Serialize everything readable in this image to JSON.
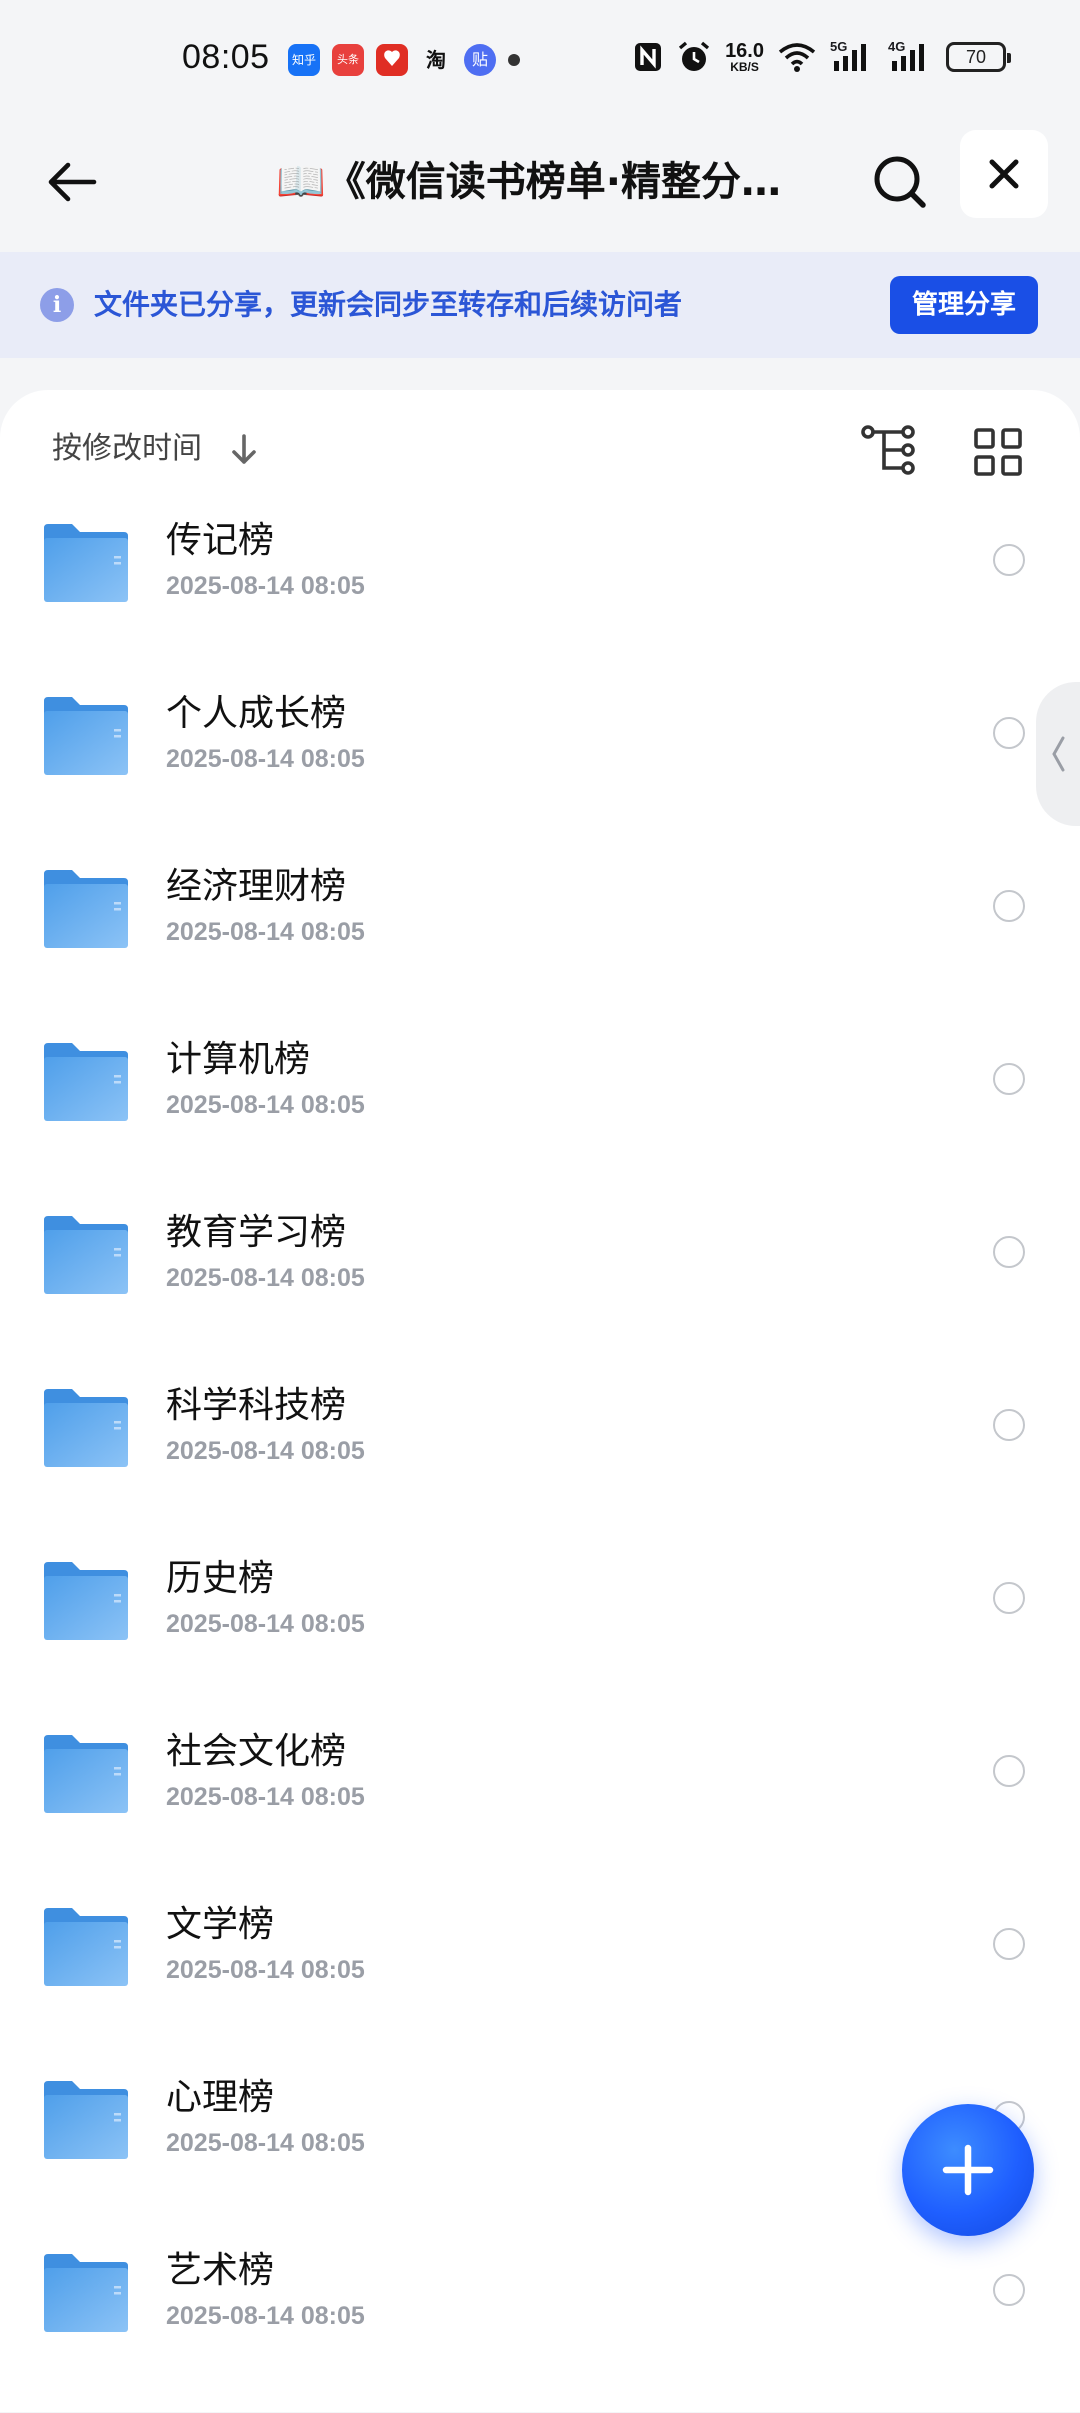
{
  "status_bar": {
    "time": "08:05",
    "notifications": [
      {
        "name": "zhihu-icon",
        "label": "知乎",
        "color": "#1772f6"
      },
      {
        "name": "toutiao-icon",
        "label": "头条",
        "color": "#e8403d"
      },
      {
        "name": "xiaohongshu-icon",
        "label": "",
        "color": "#e02e24"
      },
      {
        "name": "taobao-icon",
        "label": "淘",
        "color": "#ffffff"
      },
      {
        "name": "tieba-icon",
        "label": "贴",
        "color": "#4e6ef2"
      }
    ],
    "net_speed_value": "16.0",
    "net_speed_unit": "KB/S",
    "network_5g": "5G",
    "network_4g": "4G",
    "battery": "70"
  },
  "header": {
    "title": "📖《微信读书榜单·精整分类》"
  },
  "share_banner": {
    "text": "文件夹已分享，更新会同步至转存和后续访问者",
    "button_label": "管理分享"
  },
  "sort_bar": {
    "label": "按修改时间"
  },
  "files": [
    {
      "name": "传记榜",
      "date": "2025-08-14 08:05"
    },
    {
      "name": "个人成长榜",
      "date": "2025-08-14 08:05"
    },
    {
      "name": "经济理财榜",
      "date": "2025-08-14 08:05"
    },
    {
      "name": "计算机榜",
      "date": "2025-08-14 08:05"
    },
    {
      "name": "教育学习榜",
      "date": "2025-08-14 08:05"
    },
    {
      "name": "科学科技榜",
      "date": "2025-08-14 08:05"
    },
    {
      "name": "历史榜",
      "date": "2025-08-14 08:05"
    },
    {
      "name": "社会文化榜",
      "date": "2025-08-14 08:05"
    },
    {
      "name": "文学榜",
      "date": "2025-08-14 08:05"
    },
    {
      "name": "心理榜",
      "date": "2025-08-14 08:05"
    },
    {
      "name": "艺术榜",
      "date": "2025-08-14 08:05"
    }
  ],
  "colors": {
    "accent": "#1a4fe6",
    "folder": "#5aa9ec",
    "banner_bg": "#e9ecf8",
    "banner_text": "#2b56d6"
  }
}
